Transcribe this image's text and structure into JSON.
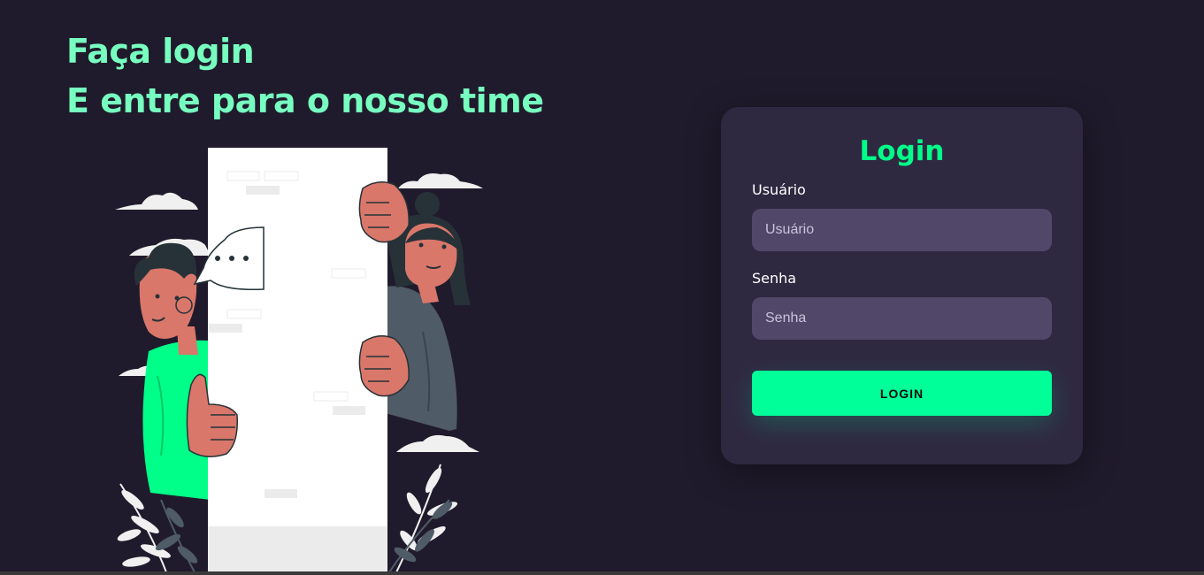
{
  "hero": {
    "line1": "Faça login",
    "line2": "E entre para o nosso time"
  },
  "illustration": {
    "icons": [
      "cloud-icon",
      "speech-bubble-icon",
      "leaf-icon"
    ],
    "colors": {
      "door": "#ffffff",
      "man_shirt": "#00ff88",
      "skin": "#d9776a",
      "woman_shirt": "#4f5b66",
      "hair": "#263238",
      "cloud": "#f0f0f0"
    }
  },
  "login_card": {
    "title": "Login",
    "username": {
      "label": "Usuário",
      "placeholder": "Usuário",
      "value": ""
    },
    "password": {
      "label": "Senha",
      "placeholder": "Senha",
      "value": ""
    },
    "submit_label": "LOGIN"
  },
  "colors": {
    "background": "#201b2c",
    "headline": "#77ffc0",
    "card": "#2f2841",
    "input": "#514869",
    "accent": "#00ff88",
    "button": "#00ff99"
  }
}
